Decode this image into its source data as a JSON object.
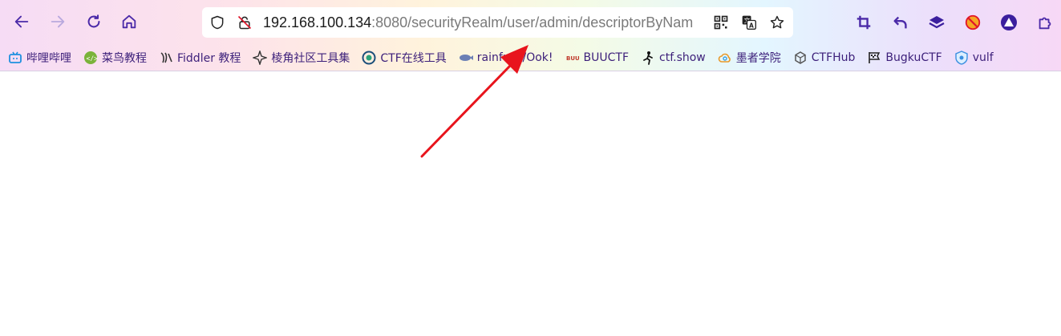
{
  "toolbar": {
    "back_icon": "arrow-left-icon",
    "forward_icon": "arrow-right-icon",
    "reload_icon": "reload-icon",
    "home_icon": "home-icon"
  },
  "address_bar": {
    "url_host": "192.168.100.134",
    "url_rest": ":8080/securityRealm/user/admin/descriptorByNam",
    "icons": [
      "shield-icon",
      "insecure-lock-icon",
      "qr-code-icon",
      "translate-icon",
      "star-icon"
    ]
  },
  "extensions": [
    "crop-icon",
    "undo-icon",
    "layers-icon",
    "blocked-icon",
    "triangle-circle-icon",
    "puzzle-icon"
  ],
  "bookmarks": [
    {
      "label": "哔哩哔哩",
      "icon": "tv-icon"
    },
    {
      "label": "菜鸟教程",
      "icon": "runoob-icon"
    },
    {
      "label": "Fiddler 教程",
      "icon": "fiddler-icon"
    },
    {
      "label": "棱角社区工具集",
      "icon": "star-shape-icon"
    },
    {
      "label": "CTF在线工具",
      "icon": "ctf-icon"
    },
    {
      "label": "rainfuck/Ook!",
      "icon": "fish-icon"
    },
    {
      "label": "BUUCTF",
      "icon": "buu-icon"
    },
    {
      "label": "ctf.show",
      "icon": "runner-icon"
    },
    {
      "label": "墨者学院",
      "icon": "cloud-icon"
    },
    {
      "label": "CTFHub",
      "icon": "cube-icon"
    },
    {
      "label": "BugkuCTF",
      "icon": "flag-icon"
    },
    {
      "label": "vulf",
      "icon": "shield-badge-icon"
    }
  ],
  "colors": {
    "accent": "#4b2aa8",
    "bookmark_text": "#3c1f7a",
    "annotation_arrow": "#e8141c"
  }
}
